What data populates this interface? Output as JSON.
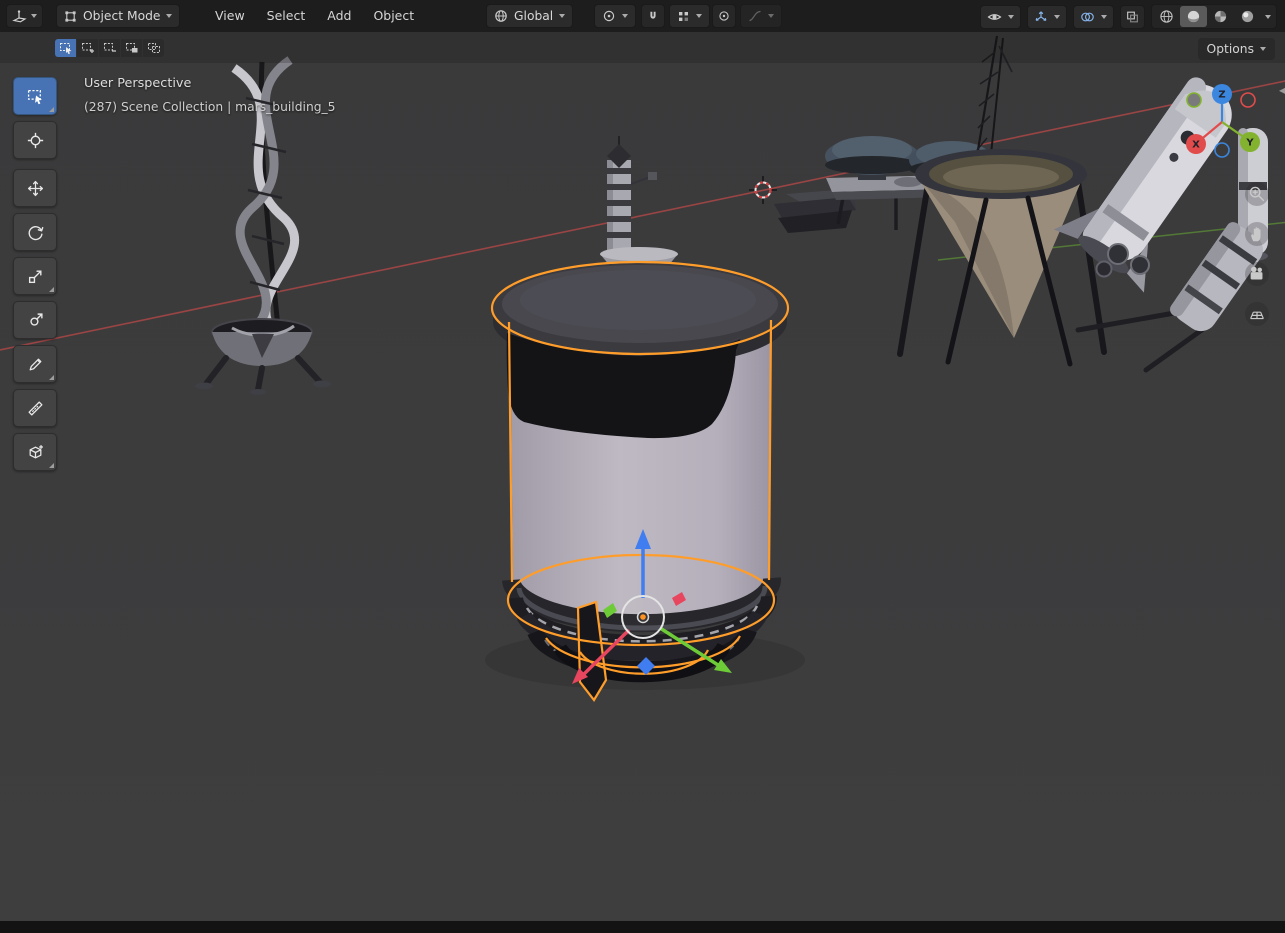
{
  "topbar": {
    "editor_icon": "3d-viewport-editor-icon",
    "mode": {
      "icon": "object-mode-icon",
      "label": "Object Mode"
    },
    "menus": [
      {
        "label": "View"
      },
      {
        "label": "Select"
      },
      {
        "label": "Add"
      },
      {
        "label": "Object"
      }
    ],
    "orientation": {
      "icon": "global-orientation-icon",
      "label": "Global"
    },
    "pivot": {
      "icon": "pivot-point-icon"
    },
    "snap": {
      "magnet_icon": "snap-magnet-icon",
      "target_icon": "snap-target-icon"
    },
    "proportional": {
      "icon": "proportional-editing-icon",
      "falloff_icon": "proportional-falloff-icon"
    },
    "right_controls": {
      "visibility_icon": "visibility-eye-icon",
      "gizmos_icon": "show-gizmos-icon",
      "overlays_icon": "show-overlays-icon",
      "xray_icon": "toggle-xray-icon",
      "shading_modes": [
        "wireframe",
        "solid",
        "material-preview",
        "rendered"
      ],
      "active_shading": "solid"
    }
  },
  "tool_header": {
    "select_modes": [
      "set",
      "extend",
      "subtract",
      "invert",
      "intersect"
    ],
    "active_select_mode": "set",
    "options_label": "Options"
  },
  "toolbar": {
    "active_tool": "select-box",
    "tools": [
      {
        "name": "select-box"
      },
      {
        "name": "cursor"
      },
      {
        "name": "move"
      },
      {
        "name": "rotate"
      },
      {
        "name": "scale"
      },
      {
        "name": "transform"
      },
      {
        "name": "annotate"
      },
      {
        "name": "measure"
      },
      {
        "name": "add-cube"
      }
    ]
  },
  "viewport": {
    "header_text": "User Perspective",
    "collection_text": "(287) Scene Collection | mars_building_5",
    "nav_gizmo": {
      "x_label": "X",
      "y_label": "Y",
      "z_label": "Z"
    },
    "side_controls": [
      "zoom",
      "pan",
      "camera-view",
      "toggle-projection"
    ]
  },
  "colors": {
    "accent": "#4772b3",
    "selection_outline": "#ff9d2b",
    "axis_x": "#e24b4b",
    "axis_y": "#83b32e",
    "axis_z": "#3b87e0",
    "header_bg": "#1d1d1d",
    "viewport_bg": "#3b3b3b"
  }
}
